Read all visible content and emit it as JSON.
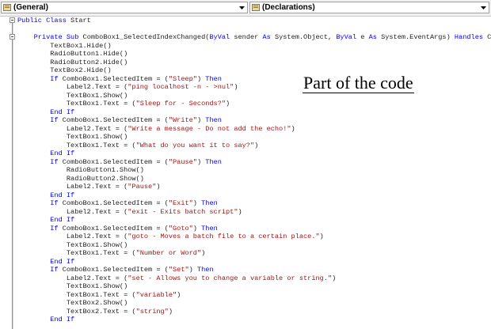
{
  "toolbar": {
    "object_dropdown": {
      "label": "(General)"
    },
    "procedure_dropdown": {
      "label": "(Declarations)"
    }
  },
  "annotation": "Part of the code",
  "code_lines": [
    [
      [
        "kw",
        "Public Class "
      ],
      [
        "tx",
        "Start"
      ]
    ],
    [],
    [
      [
        "tx",
        "    "
      ],
      [
        "kw",
        "Private Sub "
      ],
      [
        "tx",
        "ComboBox1_SelectedIndexChanged("
      ],
      [
        "kw",
        "ByVal "
      ],
      [
        "tx",
        "sender "
      ],
      [
        "kw",
        "As "
      ],
      [
        "tx",
        "System.Object, "
      ],
      [
        "kw",
        "ByVal "
      ],
      [
        "tx",
        "e "
      ],
      [
        "kw",
        "As "
      ],
      [
        "tx",
        "System.EventArgs) "
      ],
      [
        "kw",
        "Handles "
      ],
      [
        "tx",
        "Comb"
      ]
    ],
    [
      [
        "tx",
        "        TextBox1.Hide()"
      ]
    ],
    [
      [
        "tx",
        "        RadioButton1.Hide()"
      ]
    ],
    [
      [
        "tx",
        "        RadioButton2.Hide()"
      ]
    ],
    [
      [
        "tx",
        "        TextBox2.Hide()"
      ]
    ],
    [
      [
        "tx",
        "        "
      ],
      [
        "kw",
        "If "
      ],
      [
        "tx",
        "ComboBox1.SelectedItem = ("
      ],
      [
        "str",
        "\"Sleep\""
      ],
      [
        "tx",
        ") "
      ],
      [
        "kw",
        "Then"
      ]
    ],
    [
      [
        "tx",
        "            Label2.Text = ("
      ],
      [
        "str",
        "\"ping localhost -n - >nul\""
      ],
      [
        "tx",
        ")"
      ]
    ],
    [
      [
        "tx",
        "            TextBox1.Show()"
      ]
    ],
    [
      [
        "tx",
        "            TextBox1.Text = ("
      ],
      [
        "str",
        "\"Sleep for - Seconds?\""
      ],
      [
        "tx",
        ")"
      ]
    ],
    [
      [
        "tx",
        "        "
      ],
      [
        "kw",
        "End If"
      ]
    ],
    [
      [
        "tx",
        "        "
      ],
      [
        "kw",
        "If "
      ],
      [
        "tx",
        "ComboBox1.SelectedItem = ("
      ],
      [
        "str",
        "\"Write\""
      ],
      [
        "tx",
        ") "
      ],
      [
        "kw",
        "Then"
      ]
    ],
    [
      [
        "tx",
        "            Label2.Text = ("
      ],
      [
        "str",
        "\"Write a message - Do not add the echo!\""
      ],
      [
        "tx",
        ")"
      ]
    ],
    [
      [
        "tx",
        "            TextBox1.Show()"
      ]
    ],
    [
      [
        "tx",
        "            TextBox1.Text = ("
      ],
      [
        "str",
        "\"What do you want it to say?\""
      ],
      [
        "tx",
        ")"
      ]
    ],
    [
      [
        "tx",
        "        "
      ],
      [
        "kw",
        "End If"
      ]
    ],
    [
      [
        "tx",
        "        "
      ],
      [
        "kw",
        "If "
      ],
      [
        "tx",
        "ComboBox1.SelectedItem = ("
      ],
      [
        "str",
        "\"Pause\""
      ],
      [
        "tx",
        ") "
      ],
      [
        "kw",
        "Then"
      ]
    ],
    [
      [
        "tx",
        "            RadioButton1.Show()"
      ]
    ],
    [
      [
        "tx",
        "            RadioButton2.Show()"
      ]
    ],
    [
      [
        "tx",
        "            Label2.Text = ("
      ],
      [
        "str",
        "\"Pause\""
      ],
      [
        "tx",
        ")"
      ]
    ],
    [
      [
        "tx",
        "        "
      ],
      [
        "kw",
        "End If"
      ]
    ],
    [
      [
        "tx",
        "        "
      ],
      [
        "kw",
        "If "
      ],
      [
        "tx",
        "ComboBox1.SelectedItem = ("
      ],
      [
        "str",
        "\"Exit\""
      ],
      [
        "tx",
        ") "
      ],
      [
        "kw",
        "Then"
      ]
    ],
    [
      [
        "tx",
        "            Label2.Text = ("
      ],
      [
        "str",
        "\"exit - Exits batch script\""
      ],
      [
        "tx",
        ")"
      ]
    ],
    [
      [
        "tx",
        "        "
      ],
      [
        "kw",
        "End If"
      ]
    ],
    [
      [
        "tx",
        "        "
      ],
      [
        "kw",
        "If "
      ],
      [
        "tx",
        "ComboBox1.SelectedItem = ("
      ],
      [
        "str",
        "\"Goto\""
      ],
      [
        "tx",
        ") "
      ],
      [
        "kw",
        "Then"
      ]
    ],
    [
      [
        "tx",
        "            Label2.Text = ("
      ],
      [
        "str",
        "\"goto - Moves a batch file to a certain place.\""
      ],
      [
        "tx",
        ")"
      ]
    ],
    [
      [
        "tx",
        "            TextBox1.Show()"
      ]
    ],
    [
      [
        "tx",
        "            TextBox1.Text = ("
      ],
      [
        "str",
        "\"Number or Word\""
      ],
      [
        "tx",
        ")"
      ]
    ],
    [
      [
        "tx",
        "        "
      ],
      [
        "kw",
        "End If"
      ]
    ],
    [
      [
        "tx",
        "        "
      ],
      [
        "kw",
        "If "
      ],
      [
        "tx",
        "ComboBox1.SelectedItem = ("
      ],
      [
        "str",
        "\"Set\""
      ],
      [
        "tx",
        ") "
      ],
      [
        "kw",
        "Then"
      ]
    ],
    [
      [
        "tx",
        "            Label2.Text = ("
      ],
      [
        "str",
        "\"set - Allows you to change a variable or string.\""
      ],
      [
        "tx",
        ")"
      ]
    ],
    [
      [
        "tx",
        "            TextBox1.Show()"
      ]
    ],
    [
      [
        "tx",
        "            TextBox1.Text = ("
      ],
      [
        "str",
        "\"variable\""
      ],
      [
        "tx",
        ")"
      ]
    ],
    [
      [
        "tx",
        "            TextBox2.Show()"
      ]
    ],
    [
      [
        "tx",
        "            TextBox2.Text = ("
      ],
      [
        "str",
        "\"string\""
      ],
      [
        "tx",
        ")"
      ]
    ],
    [
      [
        "tx",
        "        "
      ],
      [
        "kw",
        "End If"
      ]
    ]
  ],
  "colors": {
    "keyword": "#0000ff",
    "string": "#a31515",
    "text": "#1e1e1e"
  }
}
